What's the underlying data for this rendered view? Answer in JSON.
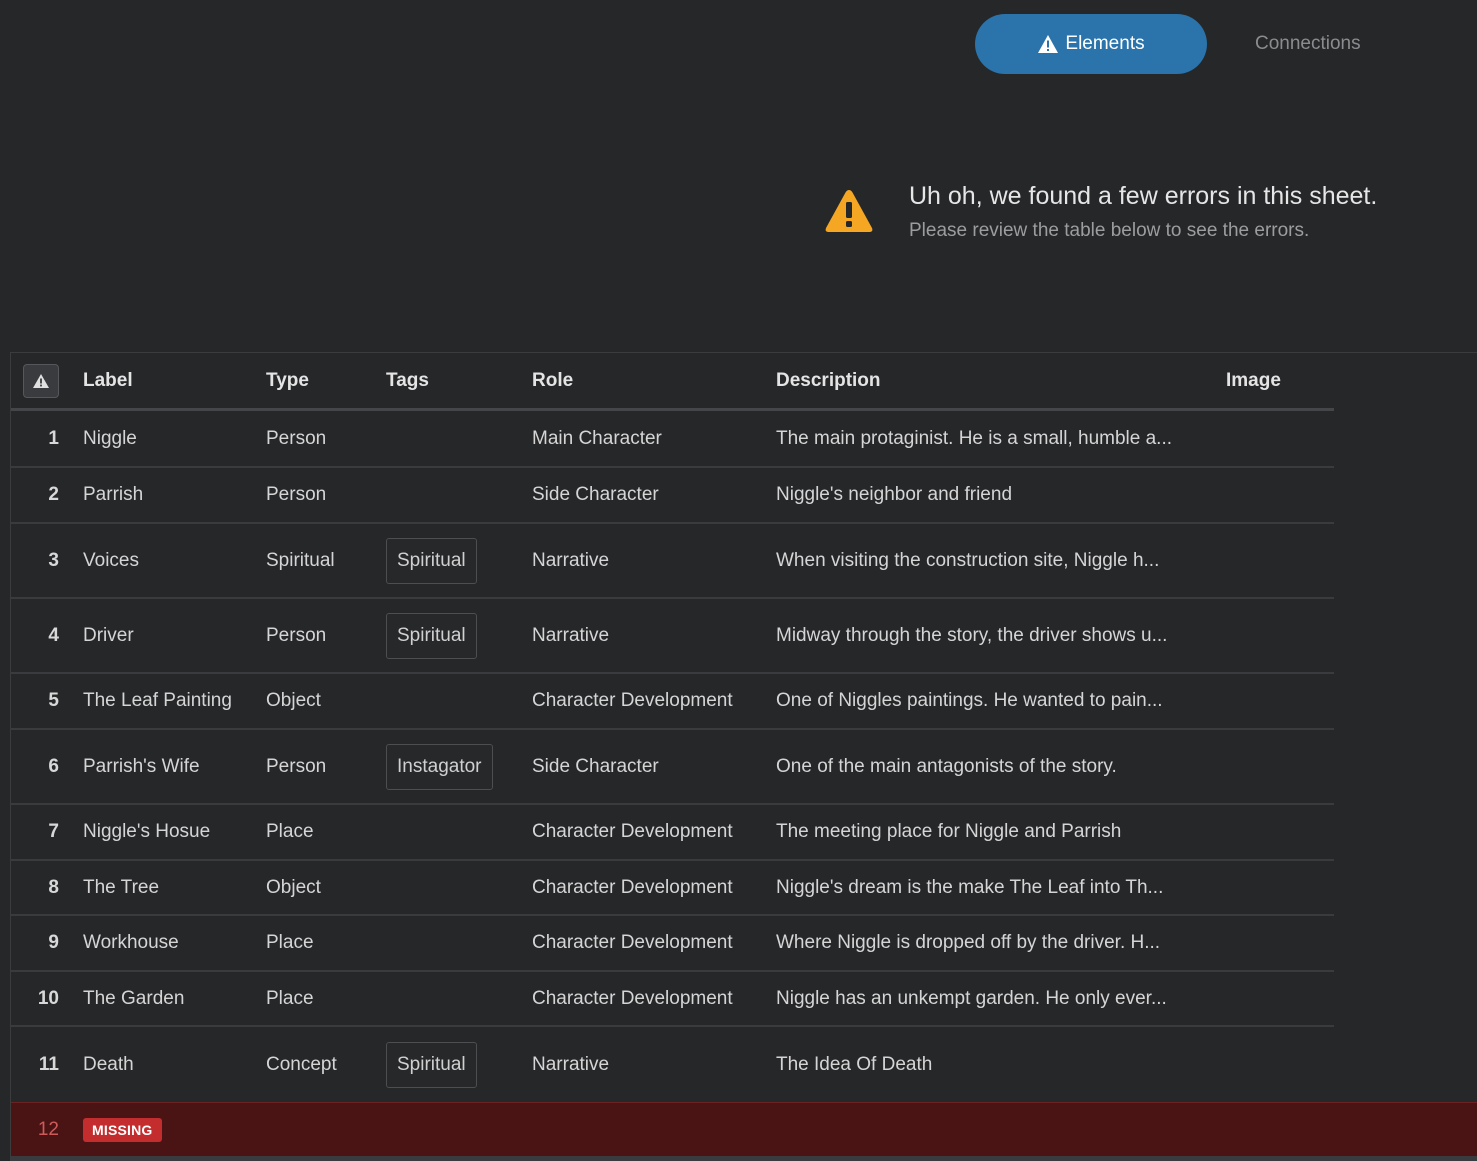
{
  "tabs": {
    "elements_label": "Elements",
    "connections_label": "Connections"
  },
  "error_banner": {
    "title": "Uh oh, we found a few errors in this sheet.",
    "subtitle": "Please review the table below to see the errors."
  },
  "table": {
    "headers": {
      "label": "Label",
      "type": "Type",
      "tags": "Tags",
      "role": "Role",
      "description": "Description",
      "image": "Image"
    },
    "rows": [
      {
        "num": "1",
        "label": "Niggle",
        "type": "Person",
        "tag": "",
        "role": "Main Character",
        "description": "The main protaginist. He is a small, humble a..."
      },
      {
        "num": "2",
        "label": "Parrish",
        "type": "Person",
        "tag": "",
        "role": "Side Character",
        "description": "Niggle's neighbor and friend"
      },
      {
        "num": "3",
        "label": "Voices",
        "type": "Spiritual",
        "tag": "Spiritual",
        "role": "Narrative",
        "description": "When visiting the construction site, Niggle h..."
      },
      {
        "num": "4",
        "label": "Driver",
        "type": "Person",
        "tag": "Spiritual",
        "role": "Narrative",
        "description": "Midway through the story, the driver shows u..."
      },
      {
        "num": "5",
        "label": "The Leaf Painting",
        "type": "Object",
        "tag": "",
        "role": "Character Development",
        "description": "One of Niggles paintings. He wanted to pain..."
      },
      {
        "num": "6",
        "label": "Parrish's Wife",
        "type": "Person",
        "tag": "Instagator",
        "role": "Side Character",
        "description": "One of the main antagonists of the story."
      },
      {
        "num": "7",
        "label": "Niggle's Hosue",
        "type": "Place",
        "tag": "",
        "role": "Character Development",
        "description": "The meeting place for Niggle and Parrish"
      },
      {
        "num": "8",
        "label": "The Tree",
        "type": "Object",
        "tag": "",
        "role": "Character Development",
        "description": "Niggle's dream is the make The Leaf into Th..."
      },
      {
        "num": "9",
        "label": "Workhouse",
        "type": "Place",
        "tag": "",
        "role": "Character Development",
        "description": "Where Niggle is dropped off by the driver. H..."
      },
      {
        "num": "10",
        "label": "The Garden",
        "type": "Place",
        "tag": "",
        "role": "Character Development",
        "description": "Niggle has an unkempt garden. He only ever..."
      },
      {
        "num": "11",
        "label": "Death",
        "type": "Concept",
        "tag": "Spiritual",
        "role": "Narrative",
        "description": "The Idea Of Death"
      }
    ],
    "error_row": {
      "num": "12",
      "badge": "MISSING"
    }
  },
  "colors": {
    "background": "#262729",
    "accent": "#2a73ab",
    "warning": "#f5a623",
    "error_row": "#4a1414",
    "missing_badge": "#c42d2d"
  },
  "icons": {
    "tab_icon": "warning-icon",
    "banner_icon": "warning-icon",
    "column_icon": "warning-icon"
  }
}
